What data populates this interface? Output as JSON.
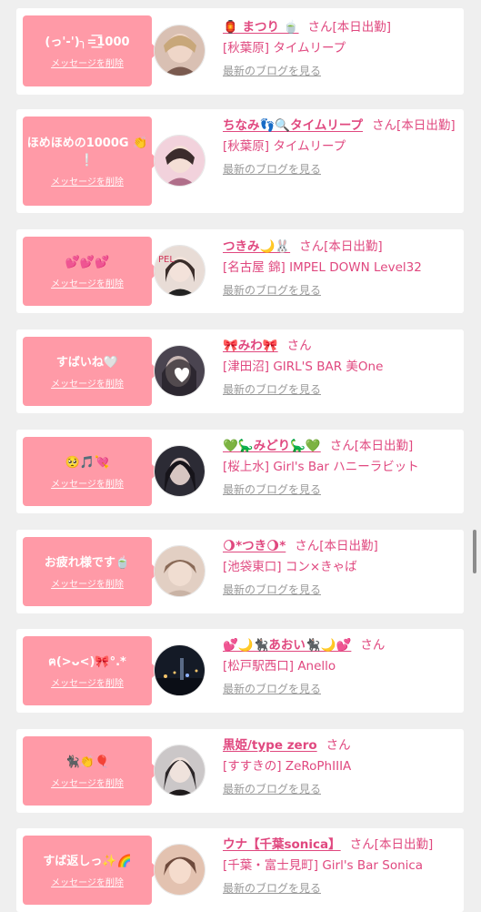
{
  "delete_label": "メッセージを削除",
  "blog_label": "最新のブログを見る",
  "san_label": "さん",
  "colors": {
    "accent": "#e0487f",
    "bubble": "#ff9aa7"
  },
  "cards": [
    {
      "message": "(っ'-')╮=͟͟͞͞1000",
      "name": "🏮 まつり 🍵",
      "status": "[本日出勤]",
      "shop": "[秋葉原] タイムリープ",
      "avatar_colors": [
        "#d9c0b3",
        "#7a5a4f"
      ]
    },
    {
      "message": "ほめほめの1000G 👏❕",
      "name": "ちなみ👣🔍タイムリープ",
      "status": "[本日出勤]",
      "shop": "[秋葉原] タイムリープ",
      "avatar_colors": [
        "#f2d2dc",
        "#b06f8a"
      ]
    },
    {
      "message": "💕💕💕",
      "name": "つきみ🌙🐰",
      "status": "[本日出勤]",
      "shop": "[名古屋 錦] IMPEL DOWN Level32",
      "avatar_colors": [
        "#e8dcd6",
        "#3a2d2a"
      ]
    },
    {
      "message": "すばいね🤍",
      "name": "🎀みわ🎀",
      "status": "",
      "shop": "[津田沼] GIRL'S BAR 美One",
      "avatar_colors": [
        "#4a4450",
        "#1f1b22"
      ]
    },
    {
      "message": "🥺🎵💘",
      "name": "💚🦕みどり🦕💚",
      "status": "[本日出勤]",
      "shop": "[桜上水] Girl's Bar ハニーラビット",
      "avatar_colors": [
        "#2c2b35",
        "#d7c6c2"
      ]
    },
    {
      "message": "お疲れ様です🍵",
      "name": "🌖*つき🌖*",
      "status": "[本日出勤]",
      "shop": "[池袋東口] コン×きゃば",
      "avatar_colors": [
        "#e2cfc3",
        "#8a6a57"
      ]
    },
    {
      "message": "ฅ(>ᴗ<)🎀°.*",
      "name": "💕🌙🐈‍⬛あおい🐈‍⬛🌙💕",
      "status": "",
      "shop": "[松戸駅西口] Anello",
      "avatar_colors": [
        "#141a26",
        "#5a6b87"
      ]
    },
    {
      "message": "🐈‍⬛👏🎈",
      "name": "黒姫/type zero",
      "status": "",
      "shop": "[すすきの] ZeRoPhIIIA",
      "avatar_colors": [
        "#cbc7c8",
        "#2b2628"
      ]
    },
    {
      "message": "すば返しっ✨🌈",
      "name": "ウナ【千葉sonica】",
      "status": "[本日出勤]",
      "shop": "[千葉・富士見町] Girl's Bar Sonica",
      "avatar_colors": [
        "#e3c2b0",
        "#6e4a3c"
      ]
    }
  ]
}
